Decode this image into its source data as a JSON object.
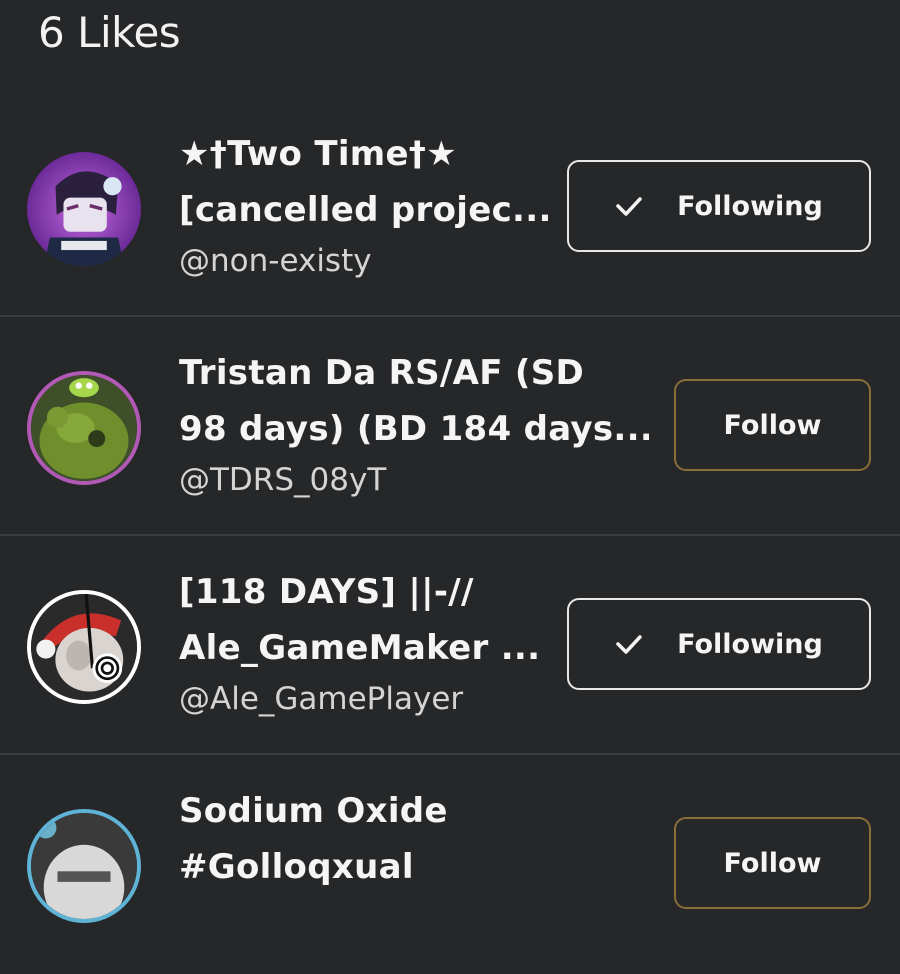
{
  "header": {
    "likes_label": "6 Likes"
  },
  "users": [
    {
      "name_line1": "★†Two Time†★",
      "name_line2": "[cancelled projec...",
      "handle": "@non-existy",
      "button_label": "Following",
      "button_state": "following"
    },
    {
      "name_line1": "Tristan Da RS/AF (SD",
      "name_line2": "98 days) (BD 184 days...",
      "handle": "@TDRS_08yT",
      "button_label": "Follow",
      "button_state": "follow"
    },
    {
      "name_line1": "[118 DAYS] ||-//",
      "name_line2": "Ale_GameMaker ...",
      "handle": "@Ale_GamePlayer",
      "button_label": "Following",
      "button_state": "following"
    },
    {
      "name_line1": "Sodium Oxide",
      "name_line2": "#Golloqxual",
      "handle": "",
      "button_label": "Follow",
      "button_state": "follow"
    }
  ],
  "colors": {
    "background": "#262729",
    "divider": "#3a3b3d",
    "following_border": "#e8e8e8",
    "follow_border": "#8a6d3b"
  },
  "icons": {
    "following_check": "check-icon"
  }
}
